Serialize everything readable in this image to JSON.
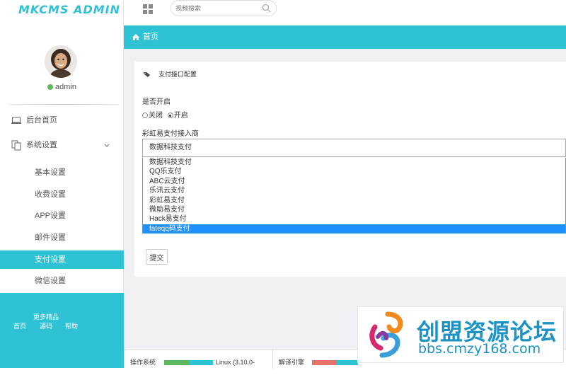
{
  "app": {
    "logo_text": "MKCMS ADMIN",
    "accent": "#2fc2d4"
  },
  "user": {
    "name": "admin",
    "status_color": "#5cb85c"
  },
  "sidebar": {
    "items": [
      {
        "label": "后台首页",
        "icon": "laptop-icon"
      },
      {
        "label": "系统设置",
        "icon": "copy-icon",
        "expanded": true
      }
    ],
    "sub_items": [
      {
        "label": "基本设置"
      },
      {
        "label": "收费设置"
      },
      {
        "label": "APP设置"
      },
      {
        "label": "邮件设置"
      },
      {
        "label": "支付设置",
        "active": true
      },
      {
        "label": "微信设置"
      }
    ],
    "footer": {
      "more": "更多精品",
      "links": [
        "首页",
        "源码",
        "帮助"
      ]
    }
  },
  "topbar": {
    "search_placeholder": "视频搜索"
  },
  "breadcrumb": {
    "home": "首页"
  },
  "panel": {
    "title": "支付接口配置",
    "enable_label": "是否开启",
    "radio_off": "关闭",
    "radio_on": "开启",
    "selected_radio": "开启",
    "provider_label": "彩虹易支付接入商",
    "provider_selected": "数据科技支付",
    "provider_options": [
      "数据科技支付",
      "QQ乐支付",
      "ABC云支付",
      "乐讯云支付",
      "彩虹易支付",
      "微助易支付",
      "Hack易支付",
      "fateqq码支付"
    ],
    "highlighted_option": "fateqq码支付",
    "submit_label": "提交"
  },
  "statusbar": {
    "os_label": "操作系统",
    "os_value": "Linux (3.10.0-",
    "engine_label": "解译引擎"
  },
  "watermark": {
    "cn": "创盟资源论坛",
    "url": "bbs.cmzy168.com"
  }
}
